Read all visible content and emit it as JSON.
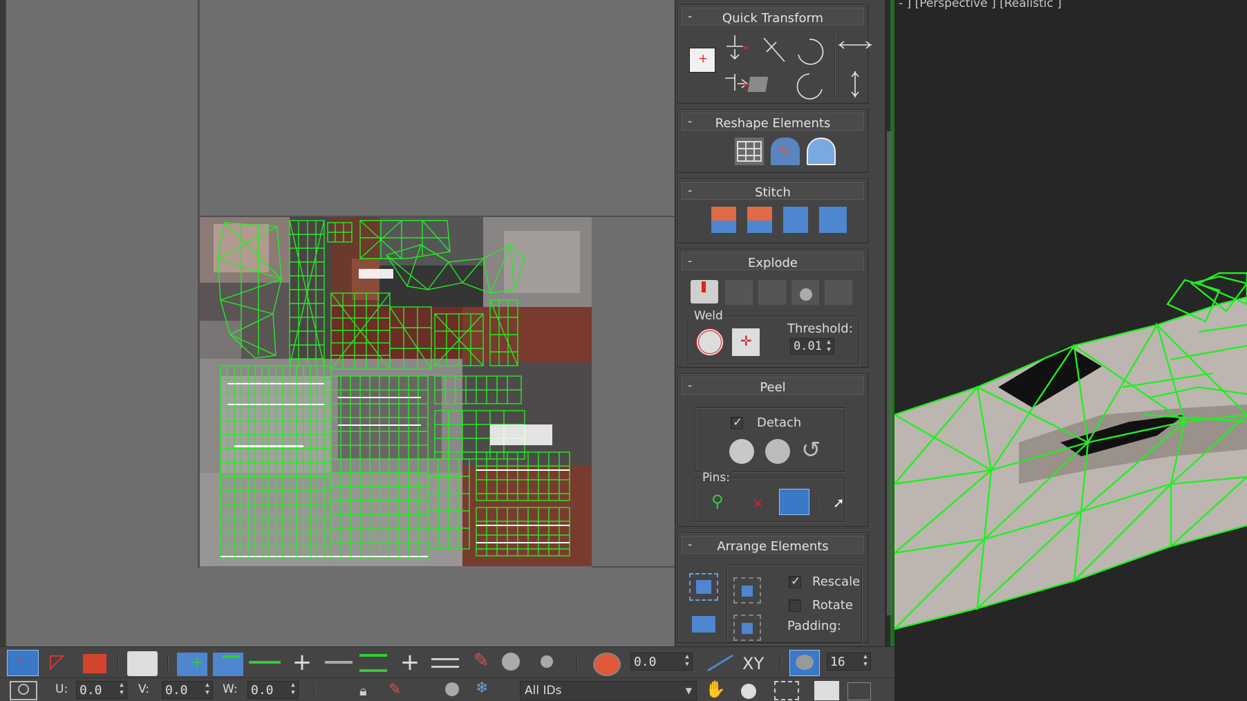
{
  "viewport": {
    "label": "- ] [Perspective ] [Realistic ]"
  },
  "rollouts": {
    "quick_transform": {
      "title": "Quick Transform",
      "collapse": "-"
    },
    "reshape_elements": {
      "title": "Reshape Elements",
      "collapse": "-"
    },
    "stitch": {
      "title": "Stitch",
      "collapse": "-"
    },
    "explode": {
      "title": "Explode",
      "collapse": "-",
      "weld_label": "Weld",
      "threshold_label": "Threshold:",
      "threshold_value": "0.01"
    },
    "peel": {
      "title": "Peel",
      "collapse": "-",
      "detach_label": "Detach",
      "detach_checked": true,
      "pins_label": "Pins:"
    },
    "arrange_elements": {
      "title": "Arrange Elements",
      "collapse": "-",
      "rescale_label": "Rescale",
      "rescale_checked": true,
      "rotate_label": "Rotate",
      "rotate_checked": false,
      "padding_label": "Padding:"
    }
  },
  "toolbar": {
    "spinner_value": "0.0",
    "xy_label": "XY",
    "grid_value": "16",
    "u_label": "U:",
    "u_value": "0.0",
    "v_label": "V:",
    "v_value": "0.0",
    "w_label": "W:",
    "w_value": "0.0",
    "ids_dropdown": "All IDs"
  },
  "colors": {
    "wireframe": "#22ee22",
    "panel_bg": "#444444",
    "uv_bg": "#6e6e6e",
    "accent_blue": "#3a78c8"
  }
}
